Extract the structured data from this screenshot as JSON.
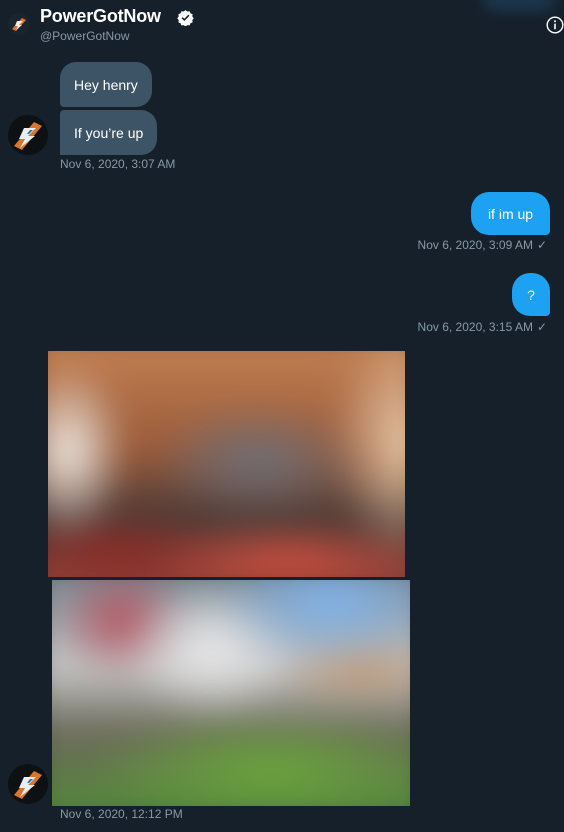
{
  "header": {
    "name": "PowerGotNow",
    "handle": "@PowerGotNow",
    "verified_icon": "verified-badge-icon",
    "info_icon": "info-icon"
  },
  "messages": {
    "in1": {
      "text": "Hey henry"
    },
    "in2": {
      "text": "If you’re up"
    },
    "in_ts": "Nov 6, 2020, 3:07 AM",
    "out1": {
      "text": "if im up",
      "ts": "Nov 6, 2020, 3:09 AM"
    },
    "out2": {
      "text": "?",
      "ts": "Nov 6, 2020, 3:15 AM"
    },
    "media_ts": "Nov 6, 2020, 12:12 PM",
    "read_mark": "✓"
  },
  "colors": {
    "background": "#15202b",
    "incoming_bubble": "#3d5466",
    "outgoing_bubble": "#1da1f2",
    "secondary_text": "#8899a6"
  }
}
